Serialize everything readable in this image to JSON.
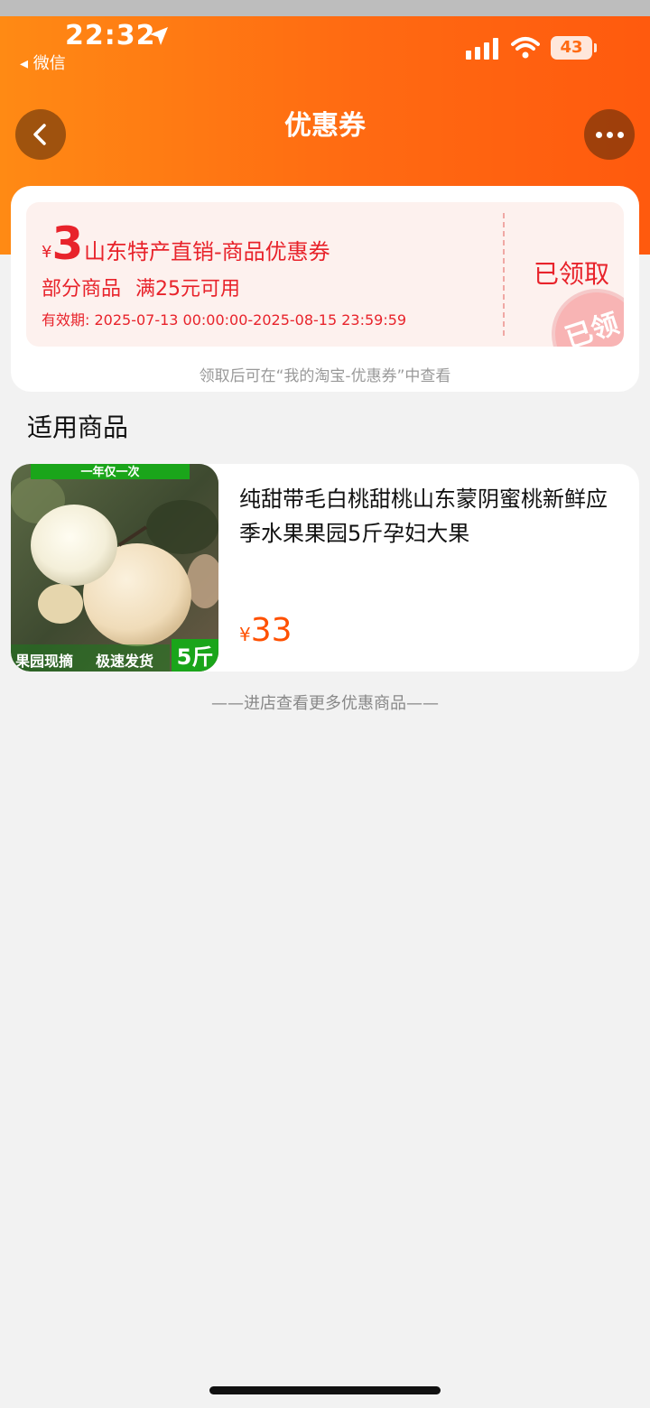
{
  "status_bar": {
    "time": "22:32",
    "back_app": "◂ 微信",
    "battery": "43",
    "icons": [
      "location-arrow-icon",
      "signal-bars-icon",
      "wifi-icon",
      "battery-icon"
    ]
  },
  "nav": {
    "title": "优惠券",
    "back_icon": "chevron-left-icon",
    "more_icon": "more-dots-icon"
  },
  "coupon": {
    "currency": "¥",
    "amount": "3",
    "name": "山东特产直销-商品优惠券",
    "scope": "部分商品",
    "threshold": "满25元可用",
    "validity": "有效期: 2025-07-13 00:00:00-2025-08-15 23:59:59",
    "status": "已领取",
    "stamp": "已领",
    "hint": "领取后可在“我的淘宝-优惠券”中查看"
  },
  "section_title": "适用商品",
  "product": {
    "name": "纯甜带毛白桃甜桃山东蒙阴蜜桃新鲜应季水果果园5斤孕妇大果",
    "currency": "¥",
    "price": "33",
    "image_banner": "一年仅一次",
    "image_tags": [
      "果园现摘",
      "极速发货"
    ],
    "image_weight": "5斤"
  },
  "more_link": "——进店查看更多优惠商品——",
  "colors": {
    "header_orange": "#ff6a12",
    "coupon_red": "#e8232b",
    "price_orange": "#ff5000",
    "image_green": "#1aa51a"
  }
}
